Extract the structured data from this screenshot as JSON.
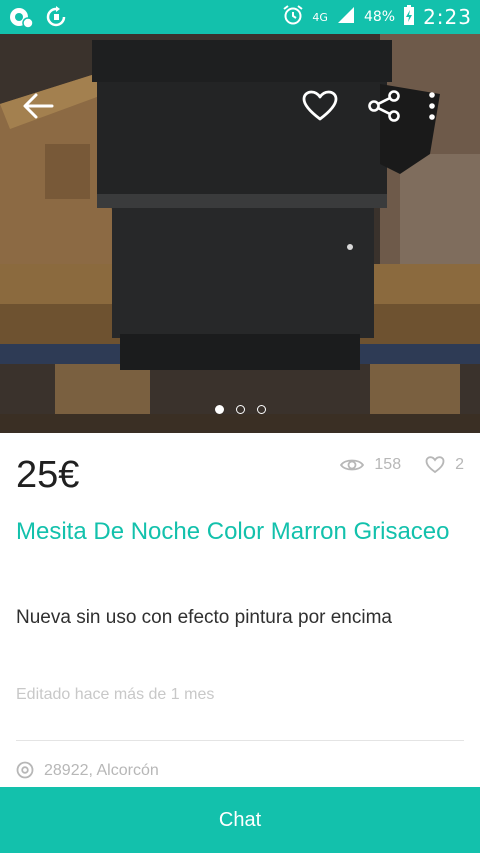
{
  "status_bar": {
    "network": "4G",
    "battery": "48%",
    "time": "2:23"
  },
  "gallery": {
    "page_count": 3,
    "active_index": 0
  },
  "listing": {
    "price": "25€",
    "views": "158",
    "favorites": "2",
    "title": "Mesita De Noche Color Marron Grisaceo",
    "description": "Nueva sin uso con efecto pintura por encima",
    "edited": "Editado hace más de 1 mes",
    "location": "28922, Alcorcón"
  },
  "actions": {
    "chat_label": "Chat"
  },
  "colors": {
    "brand": "#13c1ac",
    "price_text": "#202020",
    "muted": "#b7b7b7"
  }
}
